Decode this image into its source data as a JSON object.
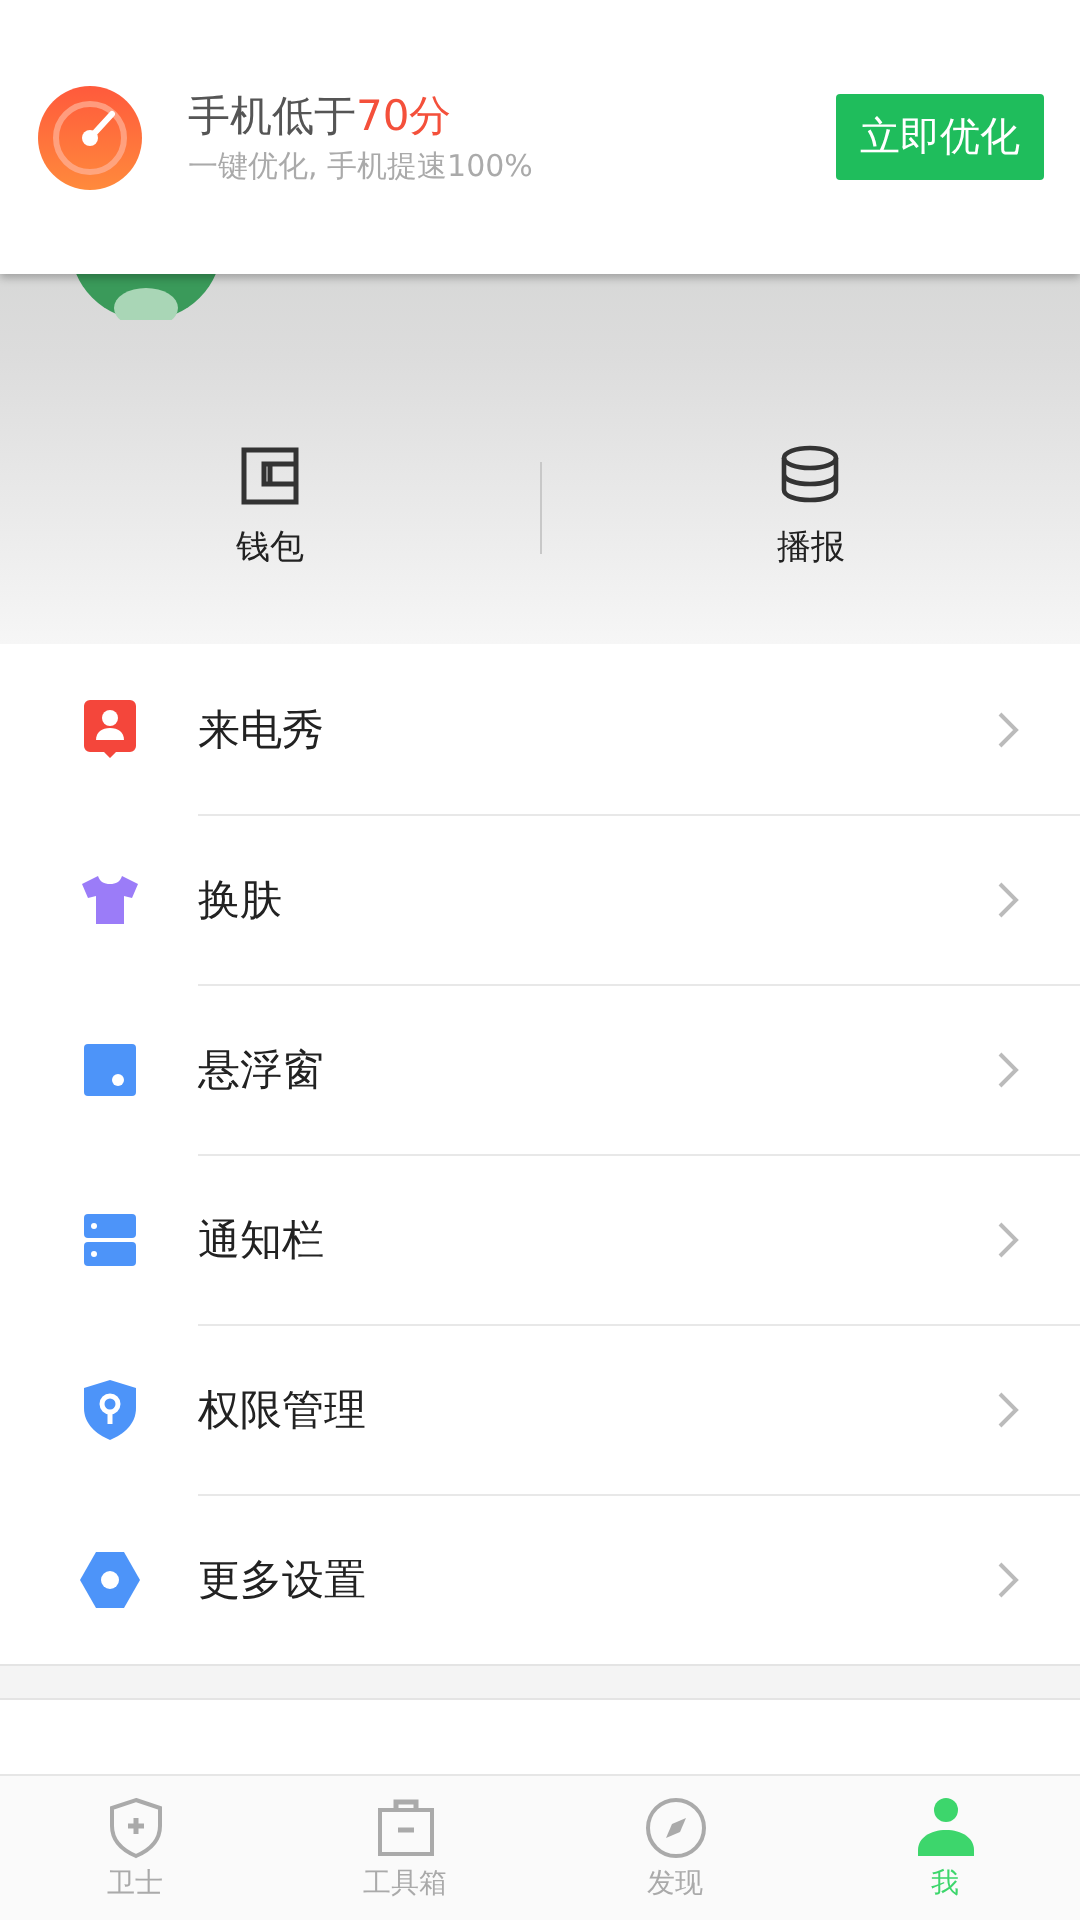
{
  "banner": {
    "title": "手机低于",
    "title_highlight": "70分",
    "subtitle": "一键优化, 手机提速100%",
    "button": "立即优化"
  },
  "shortcuts": [
    {
      "kind": "wallet",
      "label": "钱包"
    },
    {
      "kind": "stack",
      "label": "播报"
    }
  ],
  "menu": [
    {
      "kind": "person",
      "label": "来电秀",
      "color": "#f4463b"
    },
    {
      "kind": "shirt",
      "label": "换肤",
      "color": "#9b7cf8"
    },
    {
      "kind": "window",
      "label": "悬浮窗",
      "color": "#4d94f9"
    },
    {
      "kind": "bars",
      "label": "通知栏",
      "color": "#4d94f9"
    },
    {
      "kind": "shield",
      "label": "权限管理",
      "color": "#4d94f9"
    },
    {
      "kind": "hexagon",
      "label": "更多设置",
      "color": "#4d94f9"
    }
  ],
  "tabs": [
    {
      "kind": "shield",
      "label": "卫士",
      "selected": false
    },
    {
      "kind": "box",
      "label": "工具箱",
      "selected": false
    },
    {
      "kind": "compass",
      "label": "发现",
      "selected": false
    },
    {
      "kind": "person",
      "label": "我",
      "selected": true
    }
  ]
}
